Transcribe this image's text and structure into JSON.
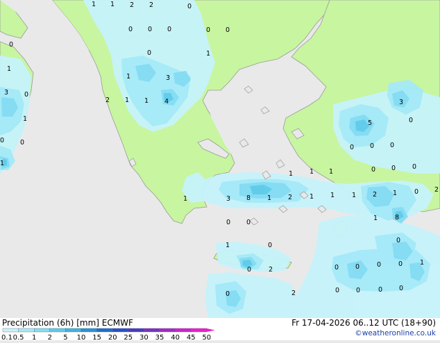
{
  "footer": {
    "title_left": "Precipitation (6h) [mm] ECMWF",
    "datetime": "Fr 17-04-2026 06..12 UTC (18+90)",
    "credit": "©weatheronline.co.uk"
  },
  "legend": {
    "values": [
      "0.1",
      "0.5",
      "1",
      "2",
      "5",
      "10",
      "15",
      "20",
      "25",
      "30",
      "35",
      "40",
      "45",
      "50"
    ],
    "colors": [
      "#e8fbff",
      "#c6f3fb",
      "#a5e9f8",
      "#84dcf3",
      "#5ecbea",
      "#3fb4e0",
      "#2793d7",
      "#1d6fd0",
      "#2a4fc8",
      "#4b3ac0",
      "#7a30c6",
      "#a52ac9",
      "#cc23cf",
      "#ee1dd3"
    ]
  },
  "map_numbers": [
    {
      "id": "n1",
      "text": "1"
    },
    {
      "id": "n2",
      "text": "1"
    },
    {
      "id": "n3",
      "text": "2"
    },
    {
      "id": "n4",
      "text": "2"
    },
    {
      "id": "n5",
      "text": "0"
    },
    {
      "id": "n6",
      "text": "0"
    },
    {
      "id": "n7",
      "text": "0"
    },
    {
      "id": "n8",
      "text": "0"
    },
    {
      "id": "n9",
      "text": "0"
    },
    {
      "id": "n10",
      "text": "0"
    },
    {
      "id": "n11",
      "text": "0"
    },
    {
      "id": "n12",
      "text": "0"
    },
    {
      "id": "n13",
      "text": "1"
    },
    {
      "id": "n14",
      "text": "3"
    },
    {
      "id": "n15",
      "text": "0"
    },
    {
      "id": "n16",
      "text": "1"
    },
    {
      "id": "n17",
      "text": "3"
    },
    {
      "id": "n18",
      "text": "2"
    },
    {
      "id": "n19",
      "text": "1"
    },
    {
      "id": "n20",
      "text": "1"
    },
    {
      "id": "n21",
      "text": "4"
    },
    {
      "id": "n22",
      "text": "1"
    },
    {
      "id": "n23",
      "text": "0"
    },
    {
      "id": "n24",
      "text": "0"
    },
    {
      "id": "n25",
      "text": "1"
    },
    {
      "id": "n26",
      "text": "1"
    },
    {
      "id": "n27",
      "text": "5"
    },
    {
      "id": "n28",
      "text": "3"
    },
    {
      "id": "n29",
      "text": "0"
    },
    {
      "id": "n30",
      "text": "0"
    },
    {
      "id": "n31",
      "text": "0"
    },
    {
      "id": "n32",
      "text": "0"
    },
    {
      "id": "n33",
      "text": "0"
    },
    {
      "id": "n34",
      "text": "0"
    },
    {
      "id": "n35",
      "text": "0"
    },
    {
      "id": "n36",
      "text": "1"
    },
    {
      "id": "n37",
      "text": "1"
    },
    {
      "id": "n38",
      "text": "1"
    },
    {
      "id": "n39",
      "text": "3"
    },
    {
      "id": "n40",
      "text": "8"
    },
    {
      "id": "n41",
      "text": "1"
    },
    {
      "id": "n42",
      "text": "2"
    },
    {
      "id": "n43",
      "text": "1"
    },
    {
      "id": "n44",
      "text": "1"
    },
    {
      "id": "n45",
      "text": "1"
    },
    {
      "id": "n46",
      "text": "2"
    },
    {
      "id": "n47",
      "text": "1"
    },
    {
      "id": "n48",
      "text": "0"
    },
    {
      "id": "n49",
      "text": "2"
    },
    {
      "id": "n50",
      "text": "1"
    },
    {
      "id": "n51",
      "text": "0"
    },
    {
      "id": "n52",
      "text": "0"
    },
    {
      "id": "n53",
      "text": "1"
    },
    {
      "id": "n54",
      "text": "0"
    },
    {
      "id": "n55",
      "text": "0"
    },
    {
      "id": "n56",
      "text": "8"
    },
    {
      "id": "n57",
      "text": "2"
    },
    {
      "id": "n58",
      "text": "0"
    },
    {
      "id": "n59",
      "text": "0"
    },
    {
      "id": "n60",
      "text": "0"
    },
    {
      "id": "n61",
      "text": "0"
    },
    {
      "id": "n62",
      "text": "1"
    },
    {
      "id": "n63",
      "text": "0"
    },
    {
      "id": "n64",
      "text": "0"
    },
    {
      "id": "n65",
      "text": "0"
    },
    {
      "id": "n66",
      "text": "0"
    },
    {
      "id": "n67",
      "text": "2"
    }
  ]
}
